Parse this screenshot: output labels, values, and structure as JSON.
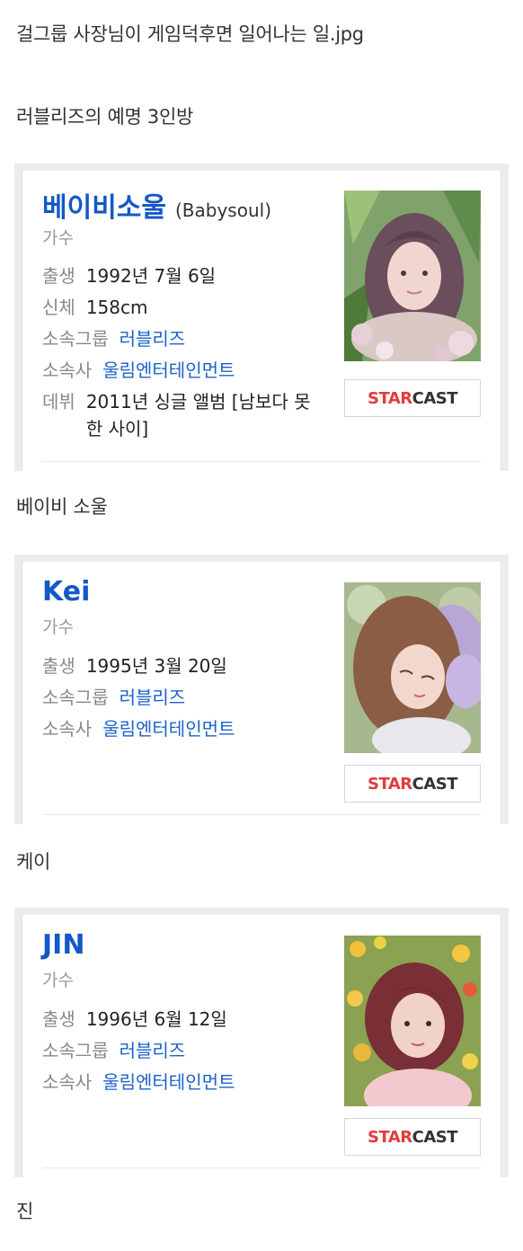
{
  "post": {
    "title": "걸그룹 사장님이 게임덕후면 일어나는 일.jpg",
    "subtitle": "러블리즈의 예명 3인방"
  },
  "cards": [
    {
      "name": "베이비소울",
      "name_en": "(Babysoul)",
      "job": "가수",
      "rows": [
        {
          "key": "출생",
          "value": "1992년 7월 6일"
        },
        {
          "key": "신체",
          "value": "158cm"
        },
        {
          "key": "소속그룹",
          "value": "러블리즈"
        },
        {
          "key": "소속사",
          "value": "울림엔터테인먼트"
        },
        {
          "key": "데뷔",
          "value": "2011년 싱글 앨범 [남보다 못한 사이]"
        }
      ],
      "caption": "베이비 소울",
      "badge_a": "STAR",
      "badge_b": "CAST"
    },
    {
      "name": "Kei",
      "job": "가수",
      "rows": [
        {
          "key": "출생",
          "value": "1995년 3월 20일"
        },
        {
          "key": "소속그룹",
          "value": "러블리즈"
        },
        {
          "key": "소속사",
          "value": "울림엔터테인먼트"
        }
      ],
      "caption": "케이",
      "badge_a": "STAR",
      "badge_b": "CAST"
    },
    {
      "name": "JIN",
      "job": "가수",
      "rows": [
        {
          "key": "출생",
          "value": "1996년 6월 12일"
        },
        {
          "key": "소속그룹",
          "value": "러블리즈"
        },
        {
          "key": "소속사",
          "value": "울림엔터테인먼트"
        }
      ],
      "caption": "진",
      "badge_a": "STAR",
      "badge_b": "CAST"
    }
  ],
  "colors": {
    "name": "#1358c8",
    "link": "#1a62c9",
    "star": "#e23c3c"
  },
  "icons": [
    "photo-babysoul",
    "photo-kei",
    "photo-jin"
  ]
}
